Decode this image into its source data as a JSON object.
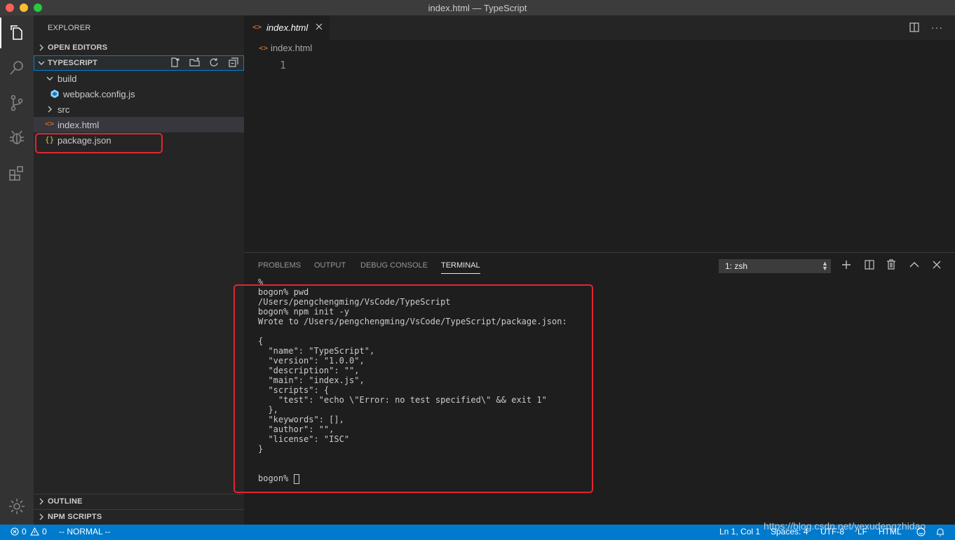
{
  "window": {
    "title": "index.html — TypeScript",
    "traffic_colors": {
      "close": "#ff5f57",
      "minimize": "#febc2e",
      "maximize": "#28c840"
    }
  },
  "activity_bar": {
    "items": [
      {
        "icon": "files-icon",
        "active": true
      },
      {
        "icon": "search-icon",
        "active": false
      },
      {
        "icon": "source-control-icon",
        "active": false
      },
      {
        "icon": "debug-icon",
        "active": false
      },
      {
        "icon": "extensions-icon",
        "active": false
      }
    ],
    "bottom_icon": "gear-icon"
  },
  "sidebar": {
    "title": "EXPLORER",
    "open_editors": "OPEN EDITORS",
    "project": "TYPESCRIPT",
    "tree": [
      {
        "label": "build",
        "type": "folder",
        "expanded": true,
        "depth": 0
      },
      {
        "label": "webpack.config.js",
        "type": "file",
        "icon": "webpack-icon",
        "depth": 1
      },
      {
        "label": "src",
        "type": "folder",
        "expanded": false,
        "depth": 0
      },
      {
        "label": "index.html",
        "type": "file",
        "icon": "html-icon",
        "depth": 0,
        "selected": true
      },
      {
        "label": "package.json",
        "type": "file",
        "icon": "json-icon",
        "depth": 0,
        "highlighted": true
      }
    ],
    "outline": "OUTLINE",
    "npm_scripts": "NPM SCRIPTS"
  },
  "editor": {
    "tab_label": "index.html",
    "breadcrumb": "index.html",
    "line_number": "1"
  },
  "panel": {
    "tabs": [
      "PROBLEMS",
      "OUTPUT",
      "DEBUG CONSOLE",
      "TERMINAL"
    ],
    "active_tab": "TERMINAL",
    "terminal_select": "1: zsh",
    "terminal_lines": [
      "%",
      "bogon% pwd",
      "/Users/pengchengming/VsCode/TypeScript",
      "bogon% npm init -y",
      "Wrote to /Users/pengchengming/VsCode/TypeScript/package.json:",
      "",
      "{",
      "  \"name\": \"TypeScript\",",
      "  \"version\": \"1.0.0\",",
      "  \"description\": \"\",",
      "  \"main\": \"index.js\",",
      "  \"scripts\": {",
      "    \"test\": \"echo \\\"Error: no test specified\\\" && exit 1\"",
      "  },",
      "  \"keywords\": [],",
      "  \"author\": \"\",",
      "  \"license\": \"ISC\"",
      "}",
      "",
      "",
      "bogon% "
    ]
  },
  "status_bar": {
    "errors": "0",
    "warnings": "0",
    "vim_mode": "-- NORMAL --",
    "position": "Ln 1, Col 1",
    "spaces": "Spaces: 4",
    "encoding": "UTF-8",
    "eol": "LF",
    "language": "HTML",
    "watermark": "https://blog.csdn.net/yexudengzhidao"
  },
  "colors": {
    "status_bar": "#007acc",
    "highlight_box": "#e0262f",
    "html_icon": "#e37933",
    "json_icon": "#cbcb41",
    "webpack_icon": "#8ed6fb"
  }
}
